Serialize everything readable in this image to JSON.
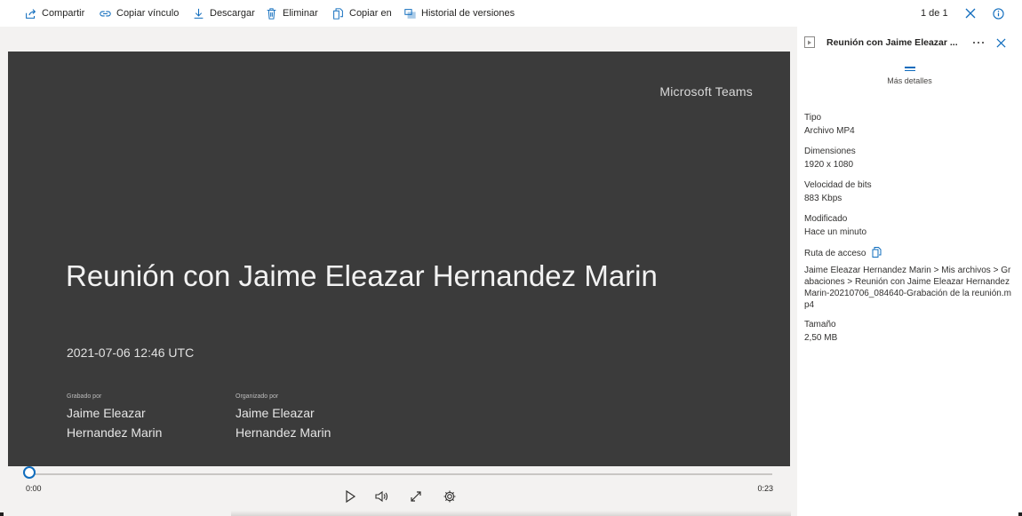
{
  "toolbar": {
    "share": "Compartir",
    "copy_link": "Copiar vínculo",
    "download": "Descargar",
    "delete": "Eliminar",
    "copy_to": "Copiar en",
    "version_history": "Historial de versiones",
    "page_indicator": "1 de 1"
  },
  "video": {
    "brand": "Microsoft Teams",
    "title": "Reunión con Jaime Eleazar Hernandez Marin",
    "date": "2021-07-06 12:46 UTC",
    "recorded_by_label": "Grabado por",
    "recorded_by_name": "Jaime Eleazar Hernandez Marin",
    "organizer_label": "Organizado por",
    "organizer_name": "Jaime Eleazar Hernandez Marin"
  },
  "player": {
    "current_time": "0:00",
    "total_time": "0:23",
    "progress": 0
  },
  "details": {
    "file_title": "Reunión con Jaime Eleazar ...",
    "more_details": "Más detalles",
    "type_label": "Tipo",
    "type_value": "Archivo MP4",
    "dimensions_label": "Dimensiones",
    "dimensions_value": "1920 x 1080",
    "bitrate_label": "Velocidad de bits",
    "bitrate_value": "883 Kbps",
    "modified_label": "Modificado",
    "modified_value": "Hace un minuto",
    "path_label": "Ruta de acceso",
    "path_value": "Jaime Eleazar Hernandez Marin > Mis archivos > Grabaciones > Reunión con Jaime Eleazar Hernandez Marin-20210706_084640-Grabación de la reunión.mp4",
    "size_label": "Tamaño",
    "size_value": "2,50 MB"
  },
  "colors": {
    "accent": "#0f6cbd",
    "video_bg": "#3b3b3b",
    "viewer_bg": "#f3f2f1"
  },
  "icons": [
    "share-icon",
    "link-icon",
    "download-icon",
    "delete-icon",
    "copy-to-icon",
    "version-history-icon",
    "close-icon",
    "info-icon",
    "play-icon",
    "volume-icon",
    "fullscreen-icon",
    "settings-icon",
    "video-file-icon",
    "more-icon",
    "copy-icon"
  ]
}
